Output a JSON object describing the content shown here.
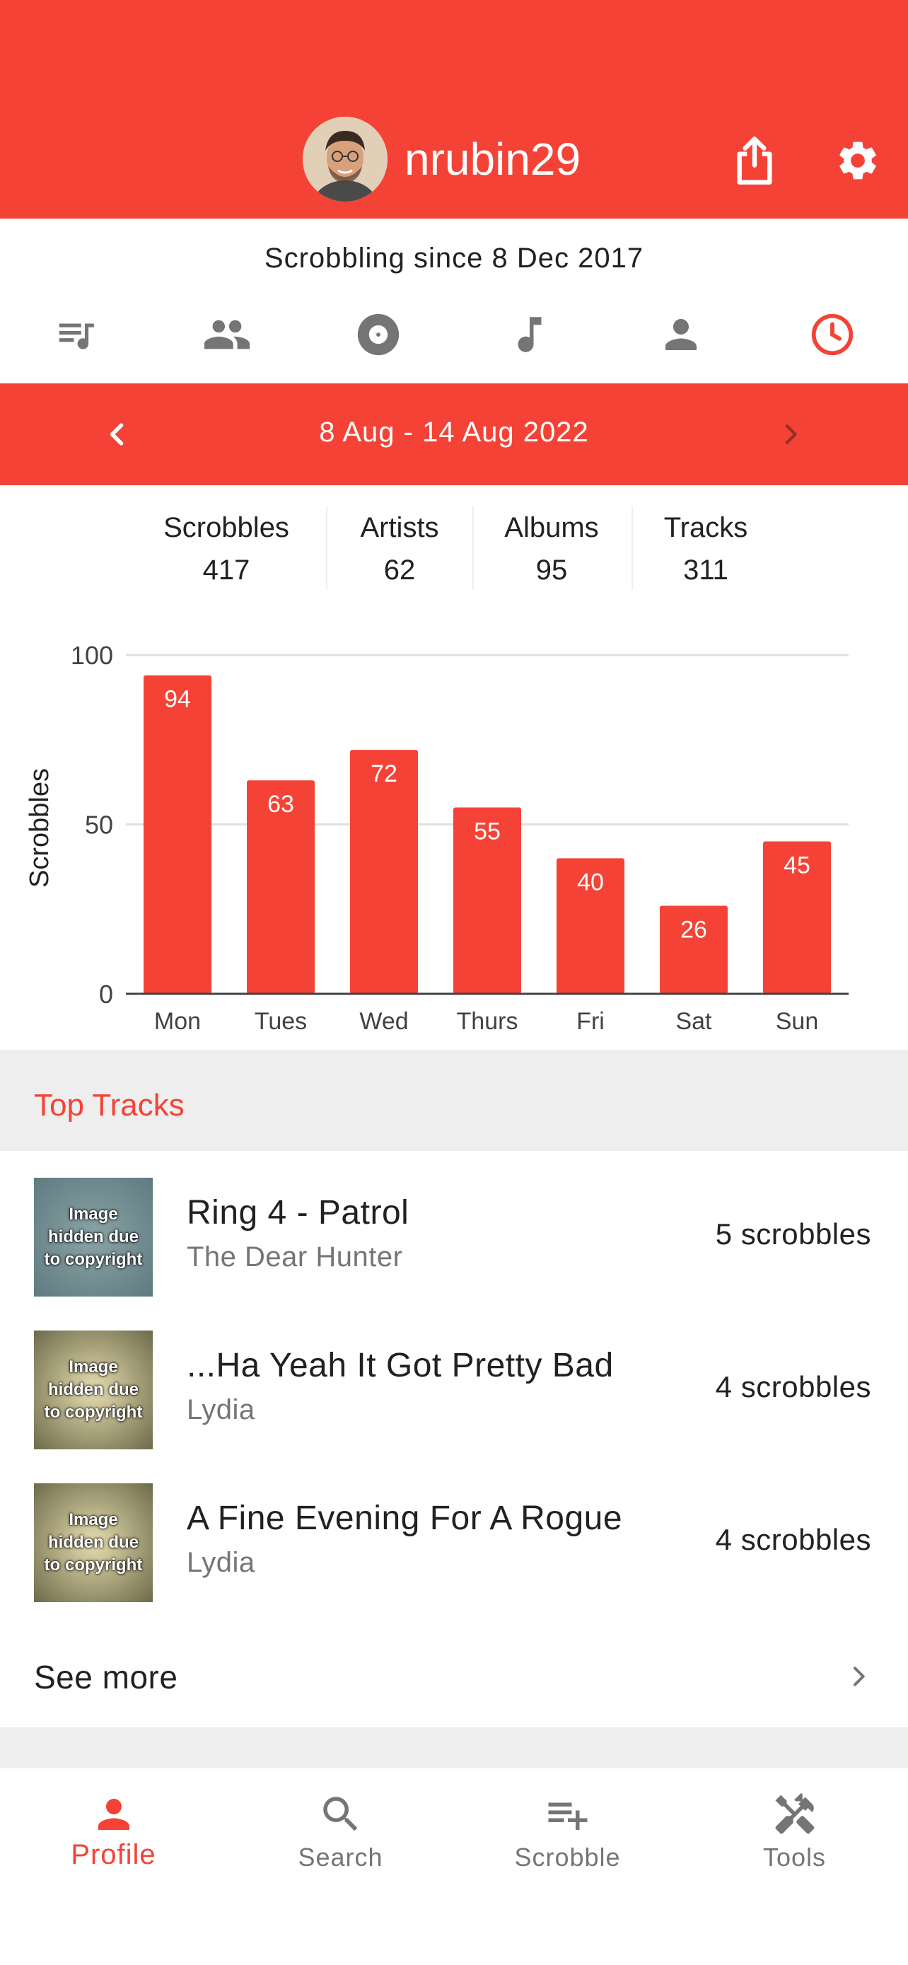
{
  "header": {
    "username": "nrubin29",
    "share_icon": "share-icon",
    "settings_icon": "gear-icon"
  },
  "profile": {
    "since": "Scrobbling since 8 Dec 2017"
  },
  "tabs": [
    {
      "icon": "queue-music-icon",
      "active": false
    },
    {
      "icon": "people-icon",
      "active": false
    },
    {
      "icon": "album-icon",
      "active": false
    },
    {
      "icon": "music-note-icon",
      "active": false
    },
    {
      "icon": "person-icon",
      "active": false
    },
    {
      "icon": "clock-icon",
      "active": true
    }
  ],
  "week": {
    "label": "8 Aug - 14 Aug 2022"
  },
  "stats": [
    {
      "label": "Scrobbles",
      "value": "417"
    },
    {
      "label": "Artists",
      "value": "62"
    },
    {
      "label": "Albums",
      "value": "95"
    },
    {
      "label": "Tracks",
      "value": "311"
    }
  ],
  "chart_data": {
    "type": "bar",
    "categories": [
      "Mon",
      "Tues",
      "Wed",
      "Thurs",
      "Fri",
      "Sat",
      "Sun"
    ],
    "values": [
      94,
      63,
      72,
      55,
      40,
      26,
      45
    ],
    "ylabel": "Scrobbles",
    "xlabel": "",
    "ylim": [
      0,
      100
    ],
    "yticks": [
      0,
      50,
      100
    ],
    "grid": true,
    "color": "#f44336"
  },
  "top_tracks": {
    "title": "Top Tracks",
    "items": [
      {
        "name": "Ring 4 - Patrol",
        "artist": "The Dear Hunter",
        "count": "5 scrobbles",
        "art_text": "Image hidden due to copyright"
      },
      {
        "name": "...Ha Yeah It Got Pretty Bad",
        "artist": "Lydia",
        "count": "4 scrobbles",
        "art_text": "Image hidden due to copyright"
      },
      {
        "name": "A Fine Evening For A Rogue",
        "artist": "Lydia",
        "count": "4 scrobbles",
        "art_text": "Image hidden due to copyright"
      }
    ],
    "see_more": "See more"
  },
  "bottom_nav": [
    {
      "label": "Profile",
      "icon": "person-icon",
      "active": true
    },
    {
      "label": "Search",
      "icon": "search-icon",
      "active": false
    },
    {
      "label": "Scrobble",
      "icon": "playlist-add-icon",
      "active": false
    },
    {
      "label": "Tools",
      "icon": "tools-icon",
      "active": false
    }
  ],
  "colors": {
    "accent": "#f44336",
    "icon_gray": "#757575",
    "divider": "#eeeeee"
  }
}
